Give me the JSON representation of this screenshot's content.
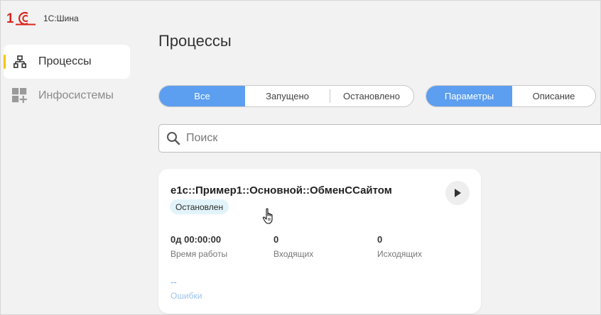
{
  "app": {
    "logo_text": "1С:Шина"
  },
  "sidebar": {
    "items": [
      {
        "label": "Процессы",
        "icon": "process-tree-icon",
        "active": true
      },
      {
        "label": "Инфосистемы",
        "icon": "infosystems-grid-icon",
        "active": false
      }
    ]
  },
  "main": {
    "title": "Процессы",
    "filter_tabs": [
      {
        "label": "Все",
        "active": true
      },
      {
        "label": "Запущено",
        "active": false
      },
      {
        "label": "Остановлено",
        "active": false
      }
    ],
    "view_tabs": [
      {
        "label": "Параметры",
        "active": true
      },
      {
        "label": "Описание",
        "active": false
      }
    ],
    "search": {
      "placeholder": "Поиск",
      "value": ""
    },
    "card": {
      "title": "e1c::Пример1::Основной::ОбменССайтом",
      "status": "Остановлен",
      "stats": [
        {
          "value": "0д 00:00:00",
          "label": "Время работы"
        },
        {
          "value": "0",
          "label": "Входящих"
        },
        {
          "value": "0",
          "label": "Исходящих"
        }
      ],
      "errors": {
        "value": "--",
        "label": "Ошибки"
      }
    }
  },
  "colors": {
    "accent": "#5c9ef0",
    "active_marker": "#f5c400",
    "badge_bg": "#e2f4fa",
    "logo_red": "#d9261c"
  }
}
